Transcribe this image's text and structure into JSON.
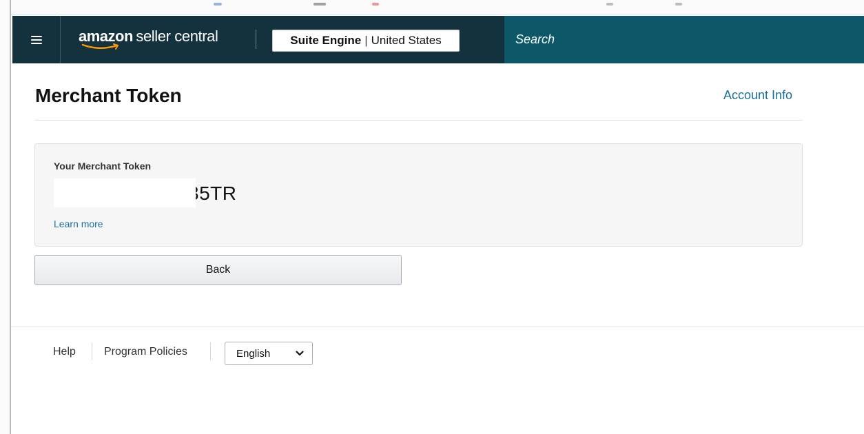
{
  "header": {
    "logo_brand": "amazon",
    "logo_product": "seller central",
    "store_name": "Suite Engine",
    "region": "United States",
    "separator": "|",
    "search_placeholder": "Search"
  },
  "page": {
    "title": "Merchant Token",
    "account_info_link": "Account Info"
  },
  "token_card": {
    "label": "Your Merchant Token",
    "value_visible": "35TR",
    "learn_more": "Learn more"
  },
  "buttons": {
    "back": "Back"
  },
  "footer": {
    "help": "Help",
    "program_policies": "Program Policies",
    "language_selected": "English"
  },
  "colors": {
    "header_bg": "#14323e",
    "search_bg": "#0c5868",
    "link": "#1a6e9e",
    "logo_smile": "#ff9900"
  },
  "icons": {
    "menu": "hamburger-icon",
    "logo_smile": "amazon-smile-icon",
    "dropdown": "chevron-down-icon"
  }
}
